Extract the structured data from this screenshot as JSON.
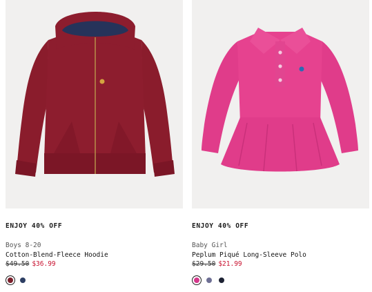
{
  "products": [
    {
      "promo": "ENJOY 40% OFF",
      "category": "Boys 8-20",
      "name": "Cotton-Blend-Fleece Hoodie",
      "original_price": "$49.50",
      "sale_price": "$36.99",
      "image_icon": "hoodie-image",
      "swatches": [
        {
          "color": "#7a1f2b",
          "selected": true
        },
        {
          "color": "#2d3e63",
          "selected": false
        }
      ]
    },
    {
      "promo": "ENJOY 40% OFF",
      "category": "Baby Girl",
      "name": "Peplum Piqué Long-Sleeve Polo",
      "original_price": "$29.50",
      "sale_price": "$21.99",
      "image_icon": "polo-image",
      "swatches": [
        {
          "color": "#d4388b",
          "selected": true
        },
        {
          "color": "#6e6f94",
          "selected": false
        },
        {
          "color": "#1d2233",
          "selected": false
        }
      ]
    }
  ],
  "colors": {
    "sale": "#c8102e",
    "image_bg": "#f1f0ef"
  }
}
